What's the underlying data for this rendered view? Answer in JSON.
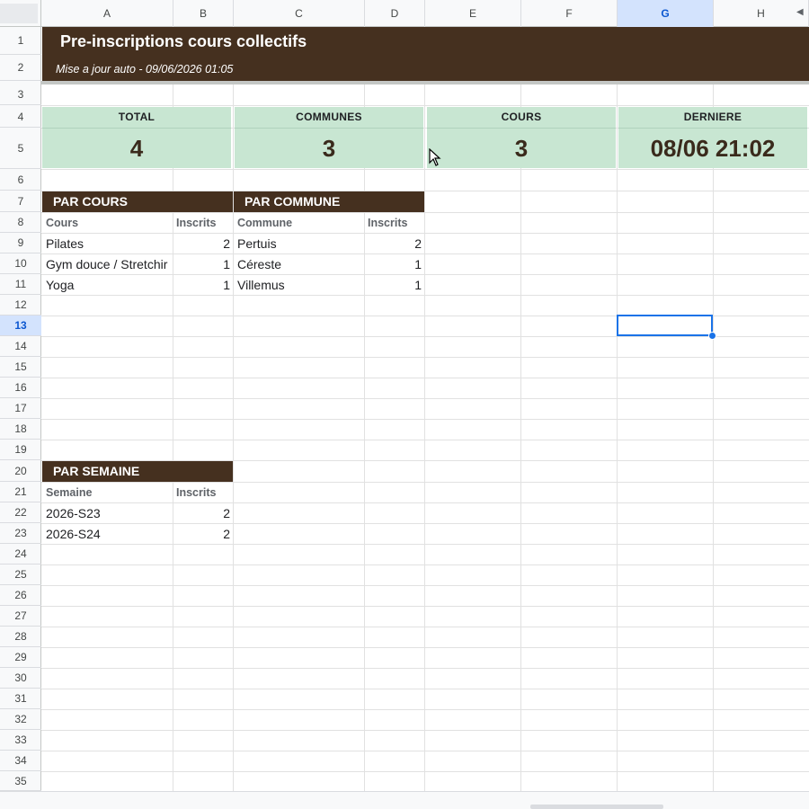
{
  "columns": [
    "A",
    "B",
    "C",
    "D",
    "E",
    "F",
    "G",
    "H"
  ],
  "rows": [
    "1",
    "2",
    "3",
    "4",
    "5",
    "6",
    "7",
    "8",
    "9",
    "10",
    "11",
    "12",
    "13",
    "14",
    "15",
    "16",
    "17",
    "18",
    "19",
    "20",
    "21",
    "22",
    "23",
    "24",
    "25",
    "26",
    "27",
    "28",
    "29",
    "30",
    "31",
    "32",
    "33",
    "34",
    "35"
  ],
  "selected": {
    "column": "G",
    "row": "13"
  },
  "title": "Pre-inscriptions cours collectifs",
  "subtitle": "Mise a jour auto - 09/06/2026 01:05",
  "stats": [
    {
      "label": "TOTAL",
      "value": "4"
    },
    {
      "label": "COMMUNES",
      "value": "3"
    },
    {
      "label": "COURS",
      "value": "3"
    },
    {
      "label": "DERNIERE",
      "value": "08/06 21:02"
    }
  ],
  "par_cours": {
    "title": "PAR COURS",
    "headers": [
      "Cours",
      "Inscrits"
    ],
    "rows": [
      {
        "name": "Pilates",
        "count": "2"
      },
      {
        "name": "Gym douce / Stretchir",
        "count": "1"
      },
      {
        "name": "Yoga",
        "count": "1"
      }
    ]
  },
  "par_commune": {
    "title": "PAR COMMUNE",
    "headers": [
      "Commune",
      "Inscrits"
    ],
    "rows": [
      {
        "name": "Pertuis",
        "count": "2"
      },
      {
        "name": "Céreste",
        "count": "1"
      },
      {
        "name": "Villemus",
        "count": "1"
      }
    ]
  },
  "par_semaine": {
    "title": "PAR SEMAINE",
    "headers": [
      "Semaine",
      "Inscrits"
    ],
    "rows": [
      {
        "name": "2026-S23",
        "count": "2"
      },
      {
        "name": "2026-S24",
        "count": "2"
      }
    ]
  },
  "colors": {
    "header_brown": "#45301f",
    "card_green": "#c8e6d2",
    "selection_blue": "#1a73e8"
  },
  "icons": [
    "scroll-left-icon",
    "mouse-pointer-icon"
  ]
}
